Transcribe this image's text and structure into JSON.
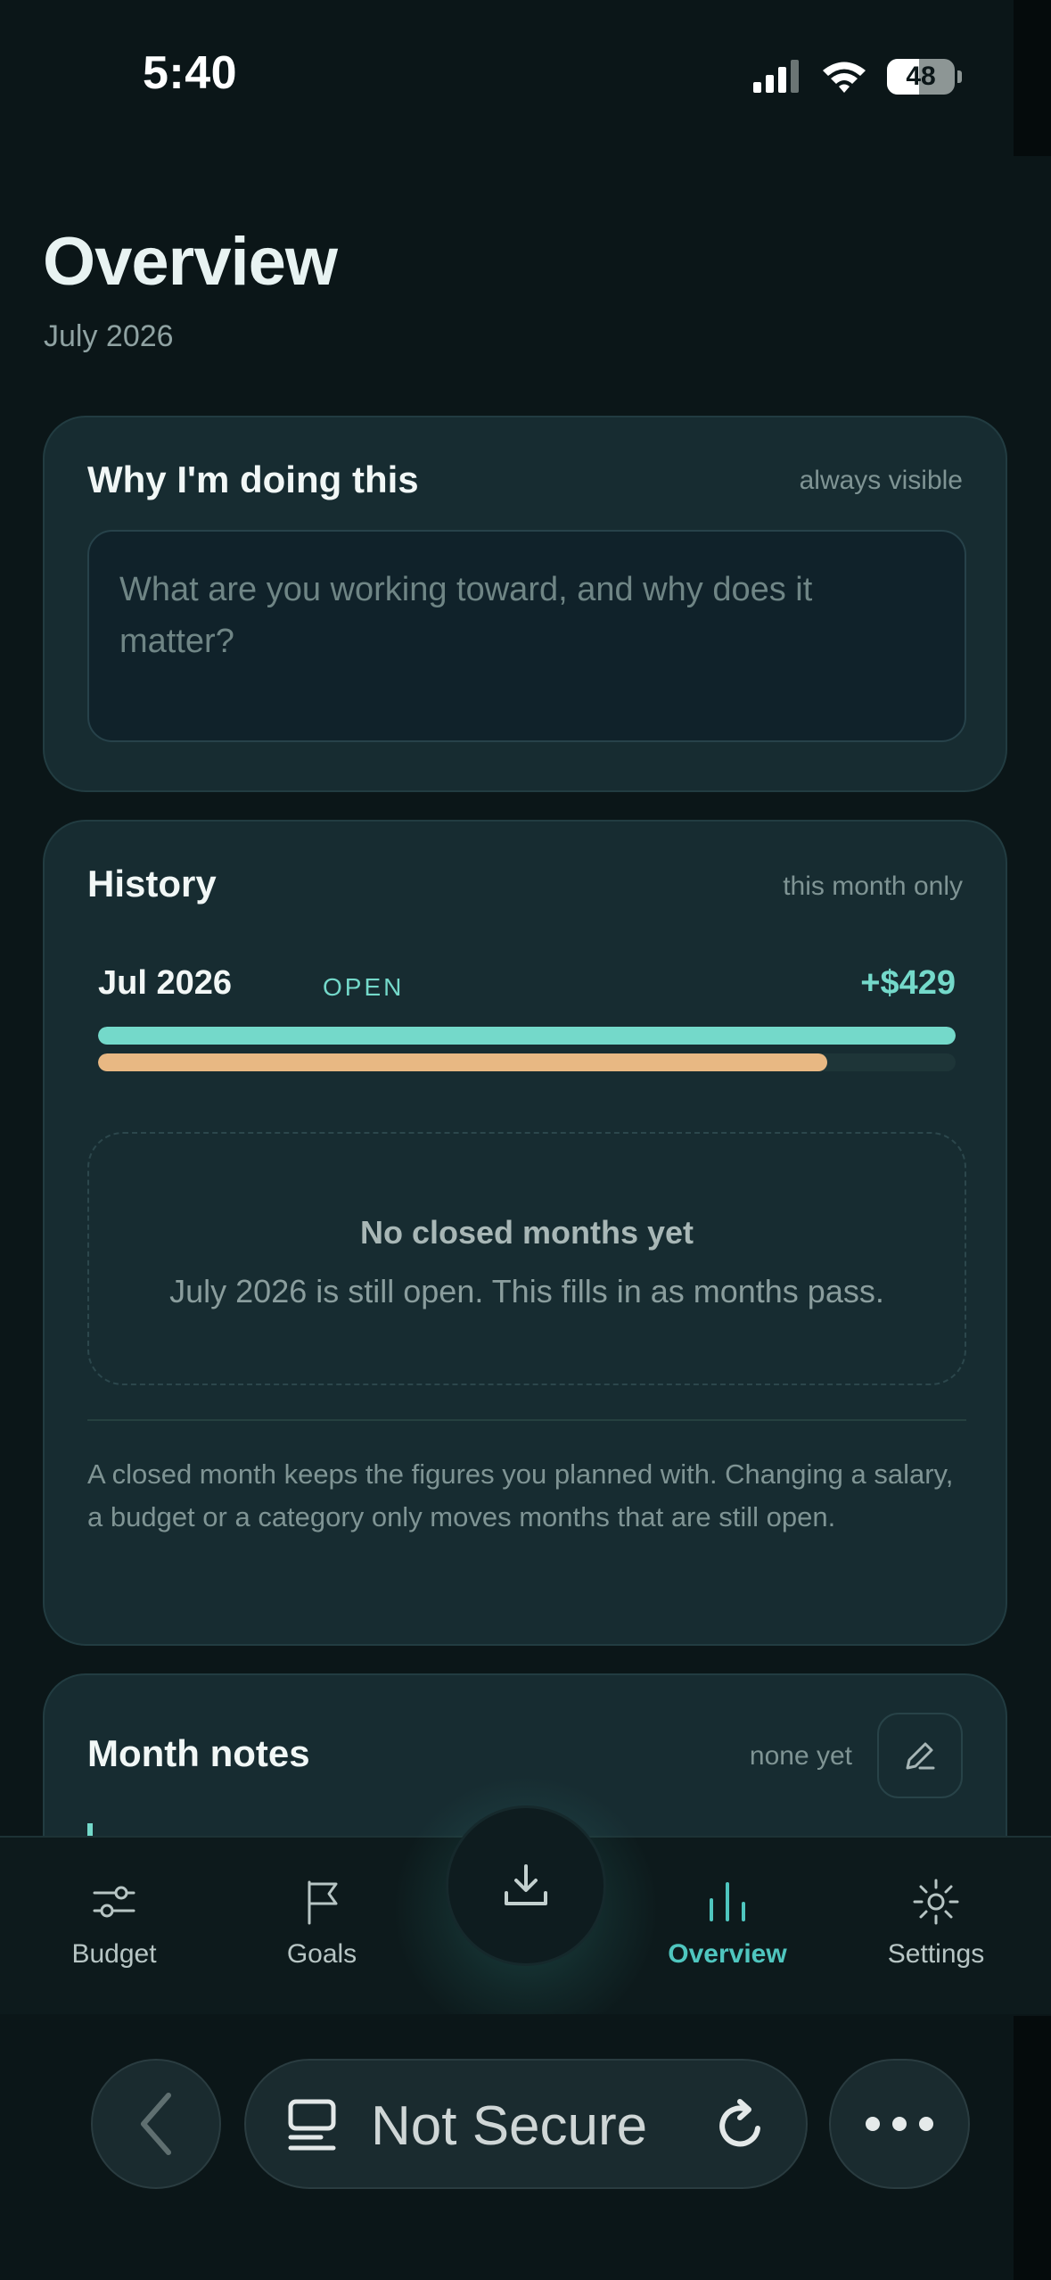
{
  "status_bar": {
    "time": "5:40",
    "battery_level": "48",
    "battery_fraction": 0.48
  },
  "header": {
    "title": "Overview",
    "subtitle": "July 2026"
  },
  "why_card": {
    "title": "Why I'm doing this",
    "meta": "always visible",
    "placeholder": "What are you working toward, and why does it matter?"
  },
  "history_card": {
    "title": "History",
    "meta": "this month only",
    "current_month": {
      "label": "Jul 2026",
      "status": "OPEN",
      "amount": "+$429",
      "income_fraction": 1.0,
      "spent_fraction": 0.85
    },
    "empty_title": "No closed months yet",
    "empty_text": "July 2026 is still open. This fills in as months pass.",
    "footnote": "A closed month keeps the figures you planned with. Changing a salary, a budget or a category only moves months that are still open."
  },
  "notes_card": {
    "title": "Month notes",
    "meta": "none yet"
  },
  "tab_bar": {
    "tabs": [
      {
        "label": "Budget",
        "icon": "sliders-icon"
      },
      {
        "label": "Goals",
        "icon": "flag-icon"
      },
      {
        "label": "Overview",
        "icon": "bar-chart-icon",
        "active": true
      },
      {
        "label": "Settings",
        "icon": "gear-icon"
      }
    ],
    "center_icon": "download-icon"
  },
  "browser_bar": {
    "address": "Not Secure",
    "back_icon": "chevron-left-icon",
    "reload_icon": "reload-icon",
    "more_icon": "more-icon"
  },
  "colors": {
    "accent": "#74d9ca",
    "spent": "#e8b883",
    "background": "#0b1618",
    "card": "#172c31",
    "tab_active": "#4fc6bf"
  }
}
